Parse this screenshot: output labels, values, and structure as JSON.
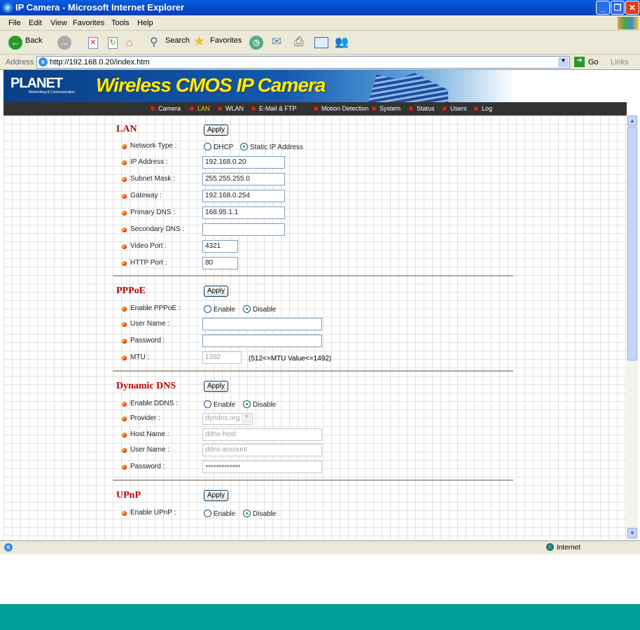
{
  "window": {
    "title": "IP Camera - Microsoft Internet Explorer"
  },
  "menu": [
    "File",
    "Edit",
    "View",
    "Favorites",
    "Tools",
    "Help"
  ],
  "toolbar": {
    "back": "Back",
    "search": "Search",
    "favorites": "Favorites"
  },
  "address": {
    "label": "Address",
    "url": "http://192.168.0.20/index.htm",
    "go": "Go",
    "links": "Links"
  },
  "banner": {
    "brand": "PLANET",
    "brand_sub": "Networking & Communication",
    "title": "Wireless CMOS IP Camera"
  },
  "nav": {
    "items": [
      "Camera",
      "LAN",
      "WLAN",
      "E-Mail & FTP",
      "Motion Detection",
      "System",
      "Status",
      "Users",
      "Log"
    ],
    "active": "LAN",
    "active_color": "#ffcc00"
  },
  "apply": "Apply",
  "lan": {
    "heading": "LAN",
    "network_type_label": "Network Type :",
    "dhcp": "DHCP",
    "static": "Static IP Address",
    "ip_label": "IP Address :",
    "ip": "192.168.0.20",
    "mask_label": "Subnet Mask :",
    "mask": "255.255.255.0",
    "gw_label": "Gateway :",
    "gw": "192.168.0.254",
    "dns1_label": "Primary DNS :",
    "dns1": "168.95.1.1",
    "dns2_label": "Secondary DNS :",
    "dns2": "",
    "video_label": "Video Port :",
    "video": "4321",
    "http_label": "HTTP Port :",
    "http": "80"
  },
  "pppoe": {
    "heading": "PPPoE",
    "enable_label": "Enable PPPoE :",
    "enable": "Enable",
    "disable": "Disable",
    "user_label": "User Name :",
    "user": "",
    "pass_label": "Password :",
    "pass": "",
    "mtu_label": "MTU :",
    "mtu": "1392",
    "mtu_note": "(512<=MTU Value<=1492)"
  },
  "ddns": {
    "heading": "Dynamic DNS",
    "enable_label": "Enable DDNS :",
    "enable": "Enable",
    "disable": "Disable",
    "provider_label": "Provider :",
    "provider": "dyndns.org",
    "host_label": "Host Name :",
    "host": "ddns-host",
    "user_label": "User Name :",
    "user": "ddns-account",
    "pass_label": "Password :",
    "pass": "●●●●●●●●●●●●●"
  },
  "upnp": {
    "heading": "UPnP",
    "enable_label": "Enable UPnP :",
    "enable": "Enable",
    "disable": "Disable"
  },
  "status": {
    "zone": "Internet"
  }
}
